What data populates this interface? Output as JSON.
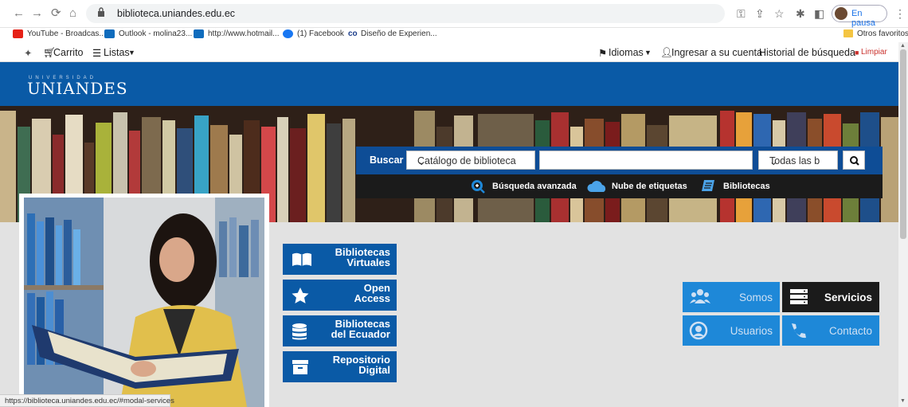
{
  "browser": {
    "url": "biblioteca.uniandes.edu.ec",
    "profile_status": "En pausa",
    "bookmarks": [
      "YouTube - Broadcas...",
      "Outlook - molina23...",
      "http://www.hotmail...",
      "(1) Facebook",
      "Diseño de Experien..."
    ],
    "other_bookmarks": "Otros favoritos"
  },
  "topbar": {
    "cart": "Carrito",
    "lists": "Listas",
    "languages": "Idiomas",
    "login": "Ingresar a su cuenta",
    "history": "Historial de búsqueda",
    "clear": "Limpiar"
  },
  "header": {
    "logo_small": "UNIVERSIDAD",
    "logo": "UNIANDES"
  },
  "search": {
    "label": "Buscar",
    "catalog": "Catálogo de biblioteca",
    "scope": "Todas las b",
    "query": "",
    "links": [
      "Búsqueda avanzada",
      "Nube de etiquetas",
      "Bibliotecas"
    ]
  },
  "left_buttons": [
    {
      "label": "Bibliotecas\nVirtuales",
      "icon": "book-icon"
    },
    {
      "label": "Open\nAccess",
      "icon": "star-icon"
    },
    {
      "label": "Bibliotecas\ndel Ecuador",
      "icon": "database-icon"
    },
    {
      "label": "Repositorio\nDigital",
      "icon": "archive-icon"
    }
  ],
  "right_buttons": {
    "somos": "Somos",
    "servicios": "Servicios",
    "usuarios": "Usuarios",
    "contacto": "Contacto"
  },
  "status_bar": "https://biblioteca.uniandes.edu.ec/#modal-services",
  "colors": {
    "brand_blue": "#0a5aa6",
    "dark": "#1b1b1b"
  }
}
